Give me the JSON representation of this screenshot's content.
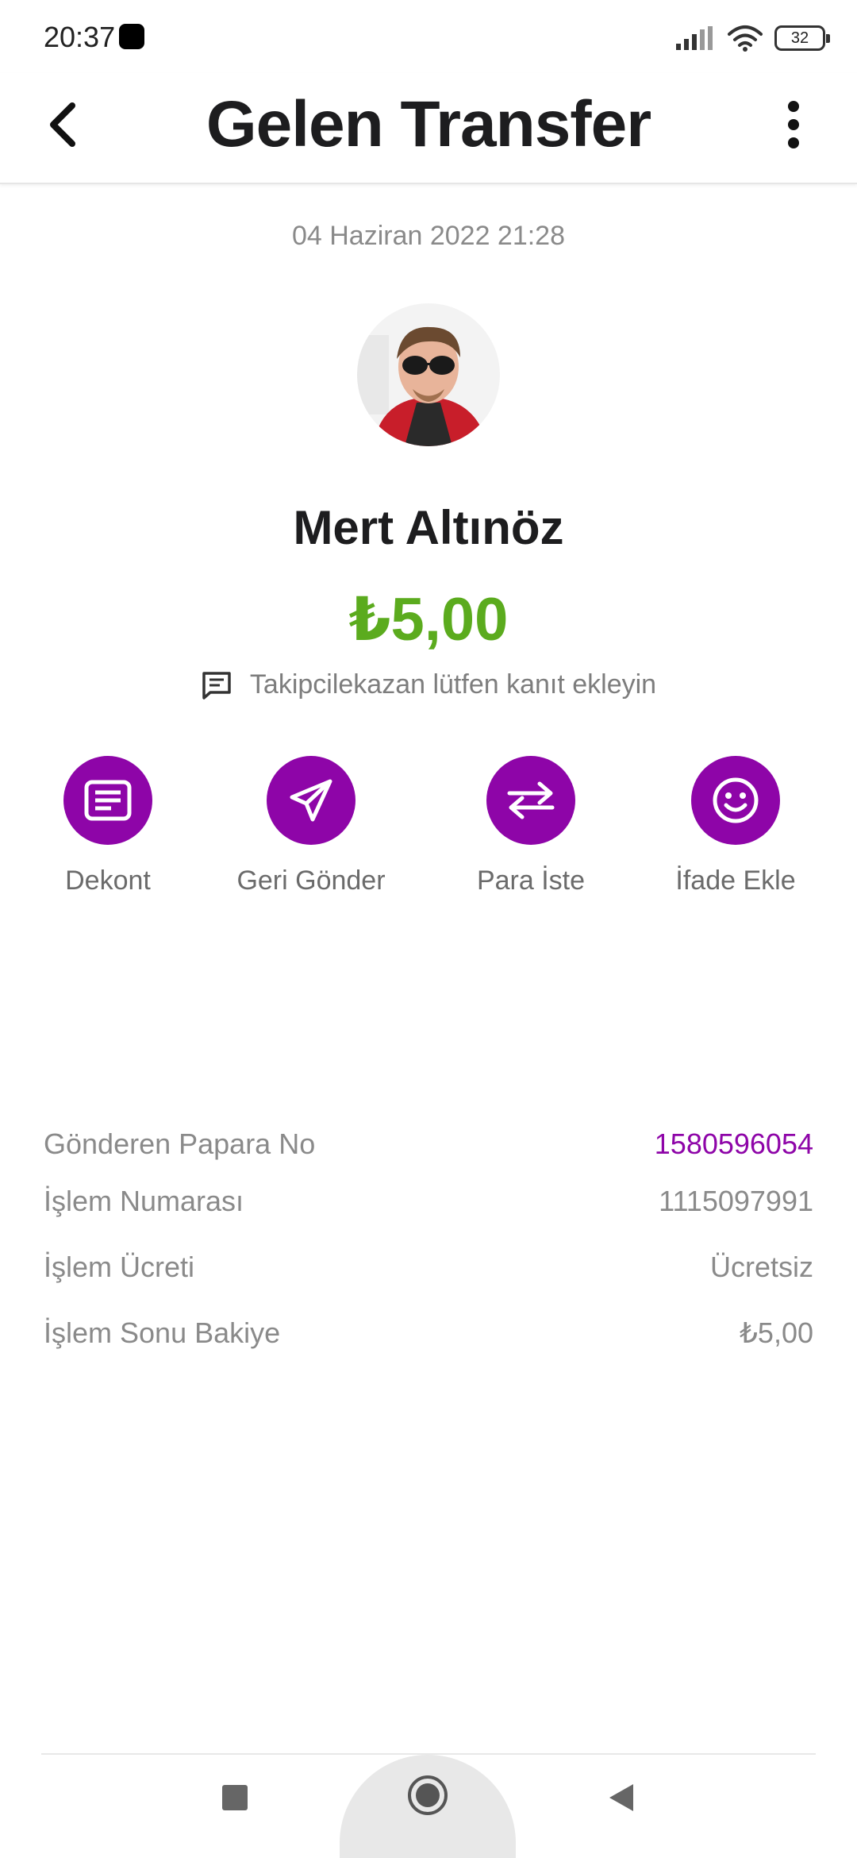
{
  "status_bar": {
    "time": "20:37",
    "battery": "32"
  },
  "header": {
    "title": "Gelen Transfer",
    "back_icon": "chevron-left-icon",
    "menu_icon": "more-vertical-icon"
  },
  "transaction": {
    "date": "04 Haziran 2022 21:28",
    "sender_name": "Mert Altınöz",
    "amount": "₺5,00",
    "note": "Takipcilekazan lütfen kanıt ekleyin"
  },
  "actions": [
    {
      "label": "Dekont",
      "icon": "receipt-icon"
    },
    {
      "label": "Geri Gönder",
      "icon": "send-icon"
    },
    {
      "label": "Para İste",
      "icon": "swap-arrows-icon"
    },
    {
      "label": "İfade Ekle",
      "icon": "smiley-icon"
    }
  ],
  "details": [
    {
      "label": "Gönderen Papara No",
      "value": "1580596054"
    },
    {
      "label": "İşlem Numarası",
      "value": "1115097991"
    },
    {
      "label": "İşlem Ücreti",
      "value": "Ücretsiz"
    },
    {
      "label": "İşlem Sonu Bakiye",
      "value": "₺5,00"
    }
  ],
  "colors": {
    "brand_purple": "#8e05a8",
    "amount_green": "#5bab1e",
    "muted_text": "#8a8a8a"
  }
}
